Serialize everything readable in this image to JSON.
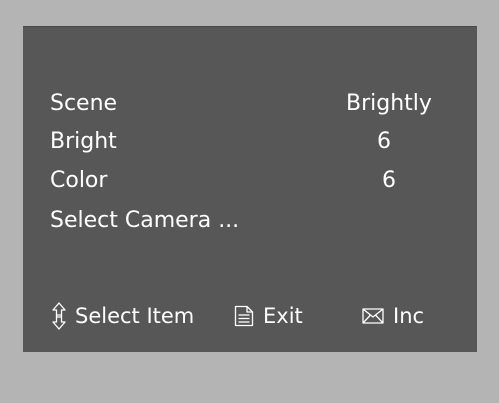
{
  "menu": {
    "items": [
      {
        "label": "Scene",
        "value": "Brightly"
      },
      {
        "label": "Bright",
        "value": "6"
      },
      {
        "label": "Color",
        "value": "6"
      },
      {
        "label": "Select Camera ...",
        "value": ""
      }
    ]
  },
  "footer": {
    "hints": [
      {
        "icon": "up-down-arrows-icon",
        "label": "Select Item"
      },
      {
        "icon": "document-icon",
        "label": "Exit"
      },
      {
        "icon": "envelope-icon",
        "label": "Inc"
      }
    ]
  },
  "colors": {
    "background": "#b4b4b4",
    "panel": "#575757",
    "text": "#ffffff"
  }
}
